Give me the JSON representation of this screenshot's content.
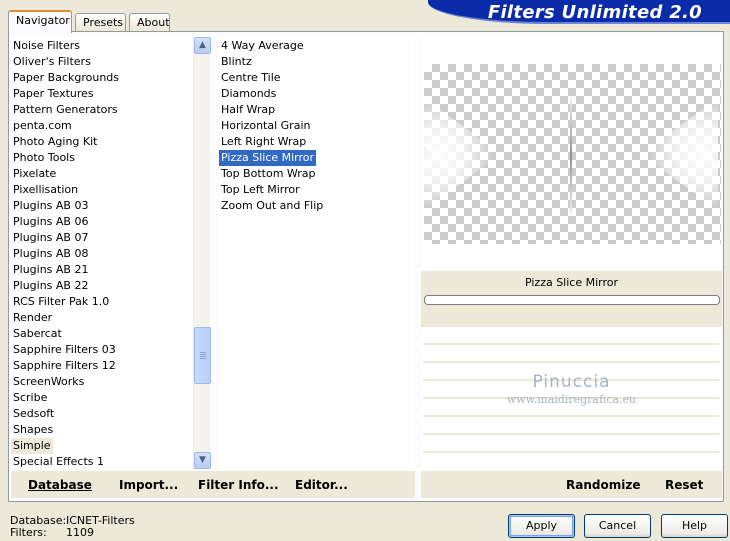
{
  "tabs": [
    {
      "label": "Navigator",
      "active": true
    },
    {
      "label": "Presets",
      "active": false
    },
    {
      "label": "About",
      "active": false
    }
  ],
  "banner": {
    "title": "Filters Unlimited 2.0"
  },
  "categories": [
    "Noise Filters",
    "Oliver's Filters",
    "Paper Backgrounds",
    "Paper Textures",
    "Pattern Generators",
    "penta.com",
    "Photo Aging Kit",
    "Photo Tools",
    "Pixelate",
    "Pixellisation",
    "Plugins AB 03",
    "Plugins AB 06",
    "Plugins AB 07",
    "Plugins AB 08",
    "Plugins AB 21",
    "Plugins AB 22",
    "RCS Filter Pak 1.0",
    "Render",
    "Sabercat",
    "Sapphire Filters 03",
    "Sapphire Filters 12",
    "ScreenWorks",
    "Scribe",
    "Sedsoft",
    "Shapes",
    "Simple",
    "Special Effects 1"
  ],
  "selected_category": "Simple",
  "filters": [
    "4 Way Average",
    "Blintz",
    "Centre Tile",
    "Diamonds",
    "Half Wrap",
    "Horizontal Grain",
    "Left Right Wrap",
    "Pizza Slice Mirror",
    "Top Bottom Wrap",
    "Top Left Mirror",
    "Zoom Out and Flip"
  ],
  "selected_filter": "Pizza Slice Mirror",
  "preview": {
    "filter_name": "Pizza Slice Mirror",
    "watermark_name": "Pinuccia",
    "watermark_url": "www.maidiregrafica.eu"
  },
  "toolbar_left": {
    "database": "Database",
    "import": "Import...",
    "filter_info": "Filter Info...",
    "editor": "Editor..."
  },
  "toolbar_right": {
    "randomize": "Randomize",
    "reset": "Reset"
  },
  "status": {
    "database_label": "Database:",
    "database_value": "ICNET-Filters",
    "filters_label": "Filters:",
    "filters_value": "1109"
  },
  "buttons": {
    "apply": "Apply",
    "cancel": "Cancel",
    "help": "Help"
  },
  "colors": {
    "selection": "#316ac5",
    "banner": "#0a2ba8",
    "window": "#ece9d8"
  }
}
